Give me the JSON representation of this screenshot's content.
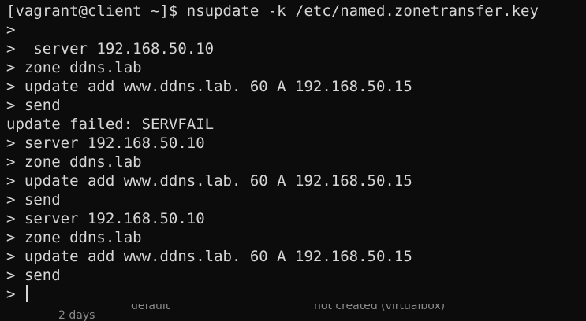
{
  "terminal": {
    "lines": [
      "[vagrant@client ~]$ nsupdate -k /etc/named.zonetransfer.key",
      ">",
      ">  server 192.168.50.10",
      "> zone ddns.lab",
      "> update add www.ddns.lab. 60 A 192.168.50.15",
      "> send",
      "update failed: SERVFAIL",
      "> server 192.168.50.10",
      "> zone ddns.lab",
      "> update add www.ddns.lab. 60 A 192.168.50.15",
      "> send",
      "> server 192.168.50.10",
      "> zone ddns.lab",
      "> update add www.ddns.lab. 60 A 192.168.50.15",
      "> send"
    ],
    "prompt": "> "
  },
  "background_window": {
    "text_1": "2 days",
    "text_2": "default",
    "text_3": "not created (virtualbox)"
  },
  "colors": {
    "background": "#0c0c0c",
    "foreground": "#d6d6d6"
  }
}
